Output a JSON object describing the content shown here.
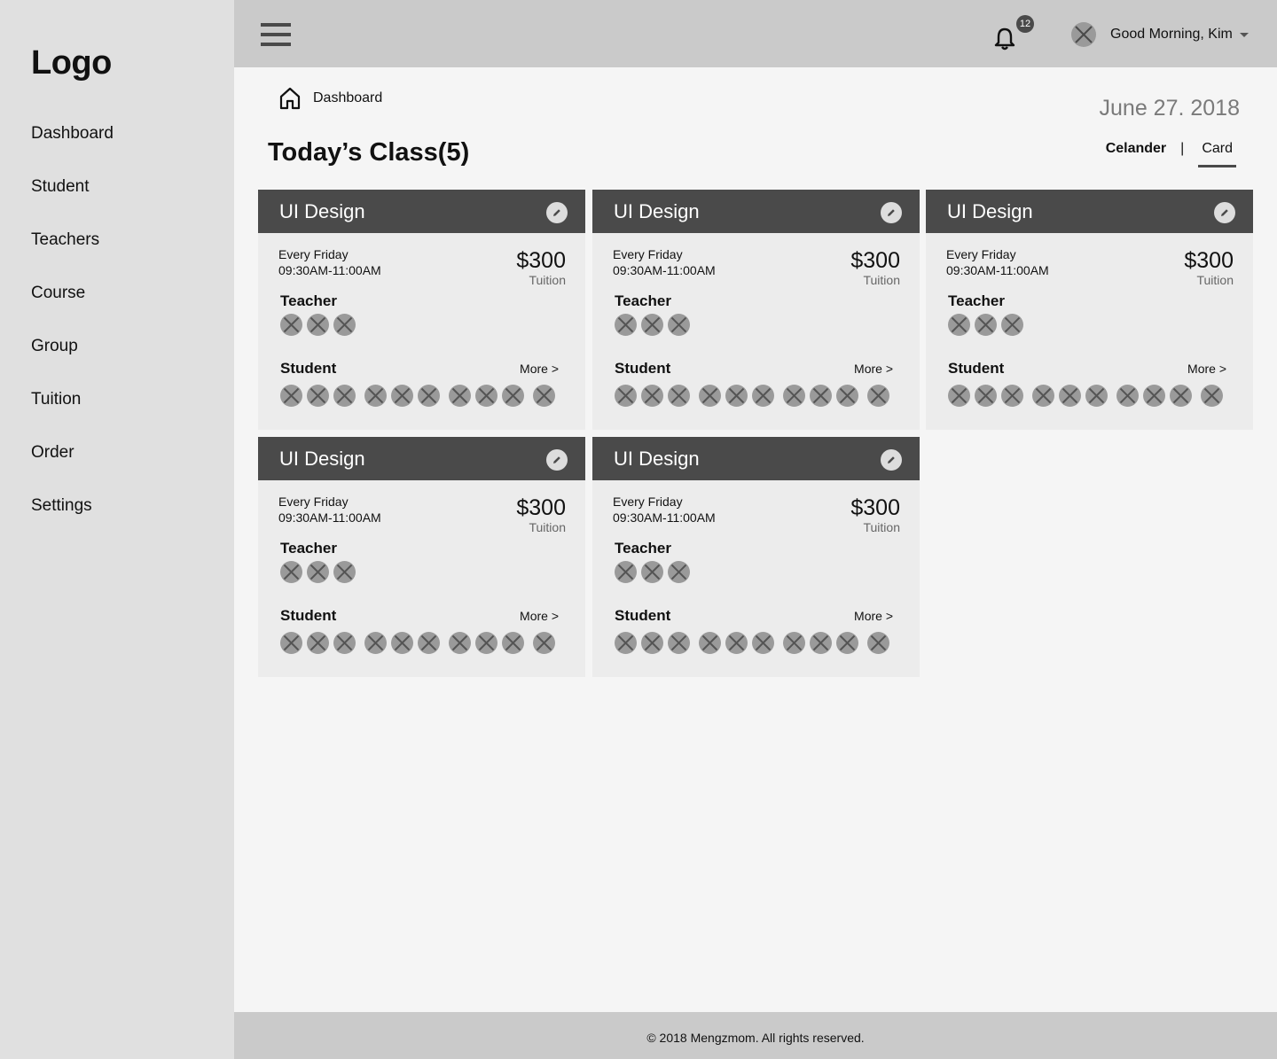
{
  "logo": "Logo",
  "nav": [
    "Dashboard",
    "Student",
    "Teachers",
    "Course",
    "Group",
    "Tuition",
    "Order",
    "Settings"
  ],
  "header": {
    "notification_count": "12",
    "greeting": "Good Morning, Kim"
  },
  "breadcrumb": {
    "label": "Dashboard"
  },
  "date": "June 27. 2018",
  "title": "Today’s Class(5)",
  "view": {
    "calendar": "Celander",
    "separator": "|",
    "card": "Card",
    "active": "Card"
  },
  "card_labels": {
    "teacher": "Teacher",
    "student": "Student",
    "more": "More >",
    "tuition": "Tuition"
  },
  "classes": [
    {
      "name": "UI Design",
      "days": "Every Friday",
      "time": "09:30AM-11:00AM",
      "price": "$300",
      "teachers": 3,
      "students": 10
    },
    {
      "name": "UI Design",
      "days": "Every Friday",
      "time": "09:30AM-11:00AM",
      "price": "$300",
      "teachers": 3,
      "students": 10
    },
    {
      "name": "UI Design",
      "days": "Every Friday",
      "time": "09:30AM-11:00AM",
      "price": "$300",
      "teachers": 3,
      "students": 10
    },
    {
      "name": "UI Design",
      "days": "Every Friday",
      "time": "09:30AM-11:00AM",
      "price": "$300",
      "teachers": 3,
      "students": 10
    },
    {
      "name": "UI Design",
      "days": "Every Friday",
      "time": "09:30AM-11:00AM",
      "price": "$300",
      "teachers": 3,
      "students": 10
    }
  ],
  "footer": "© 2018 Mengzmom. All rights reserved.",
  "colors": {
    "sidebar": "#e0e0e0",
    "topbar": "#cacaca",
    "card_header": "#4a4a4a",
    "card_body": "#ececec",
    "page": "#f5f5f5"
  }
}
